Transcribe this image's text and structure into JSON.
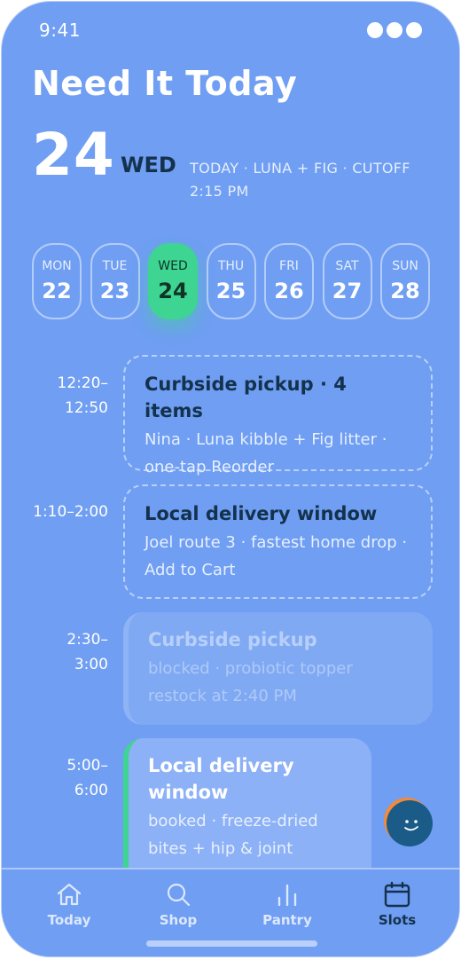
{
  "status": {
    "time": "9:41"
  },
  "header": {
    "title": "Need It Today",
    "day_number": "24",
    "weekday": "WED",
    "meta": "TODAY · LUNA + FIG · CUTOFF 2:15 PM"
  },
  "datestrip": [
    {
      "dow": "MON",
      "num": "22"
    },
    {
      "dow": "TUE",
      "num": "23"
    },
    {
      "dow": "WED",
      "num": "24",
      "active": true
    },
    {
      "dow": "THU",
      "num": "25"
    },
    {
      "dow": "FRI",
      "num": "26"
    },
    {
      "dow": "SAT",
      "num": "27"
    },
    {
      "dow": "SUN",
      "num": "28"
    }
  ],
  "slots": [
    {
      "time": "12:20–\n12:50",
      "title": "Curbside pickup · 4 items",
      "detail": "Nina · Luna kibble + Fig litter · one-tap Reorder",
      "state": "available"
    },
    {
      "time": "1:10–2:00",
      "title": "Local delivery window",
      "detail": "Joel route 3 · fastest home drop · Add to Cart",
      "state": "available"
    },
    {
      "time": "2:30–\n3:00",
      "title": "Curbside pickup",
      "detail": "blocked · probiotic topper restock at 2:40 PM",
      "state": "blocked"
    },
    {
      "time": "5:00–\n6:00",
      "title": "Local delivery window",
      "detail": "booked · freeze-dried bites + hip & joint",
      "state": "booked"
    }
  ],
  "tabs": [
    {
      "label": "Today",
      "icon": "home-icon"
    },
    {
      "label": "Shop",
      "icon": "search-icon"
    },
    {
      "label": "Pantry",
      "icon": "bar-chart-icon"
    },
    {
      "label": "Slots",
      "icon": "calendar-icon",
      "active": true
    }
  ],
  "colors": {
    "background": "#6f9ef2",
    "accent_green": "#3ed492",
    "text_dark": "#14324d",
    "avatar_blue": "#1a5b87",
    "avatar_ring": "#f28a3a"
  }
}
